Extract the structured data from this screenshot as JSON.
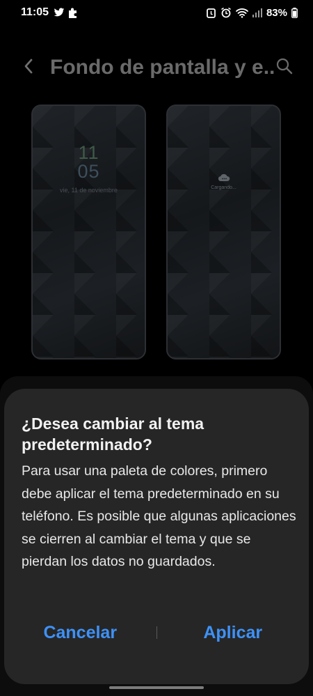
{
  "status_bar": {
    "time": "11:05",
    "battery_percent": "83%",
    "left_icons": [
      "twitter-icon",
      "puzzle-icon"
    ],
    "right_icons": [
      "alarm-icon",
      "alarm-clock-icon",
      "wifi-icon",
      "signal-icon",
      "battery-icon"
    ]
  },
  "header": {
    "title": "Fondo de pantalla y e..."
  },
  "lock_preview": {
    "hour": "11",
    "minute": "05",
    "date": "vie, 11 de noviembre"
  },
  "home_preview": {
    "loading_text": "Cargando..."
  },
  "dialog": {
    "title": "¿Desea cambiar al tema predeterminado?",
    "body": "Para usar una paleta de colores, primero debe aplicar el tema predeterminado en su teléfono. Es posible que algunas aplicaciones se cierren al cambiar el tema y que se pierdan los datos no guardados.",
    "cancel_label": "Cancelar",
    "apply_label": "Aplicar"
  },
  "colors": {
    "accent": "#3e91f7",
    "dialog_bg": "#262626",
    "background": "#000000"
  }
}
